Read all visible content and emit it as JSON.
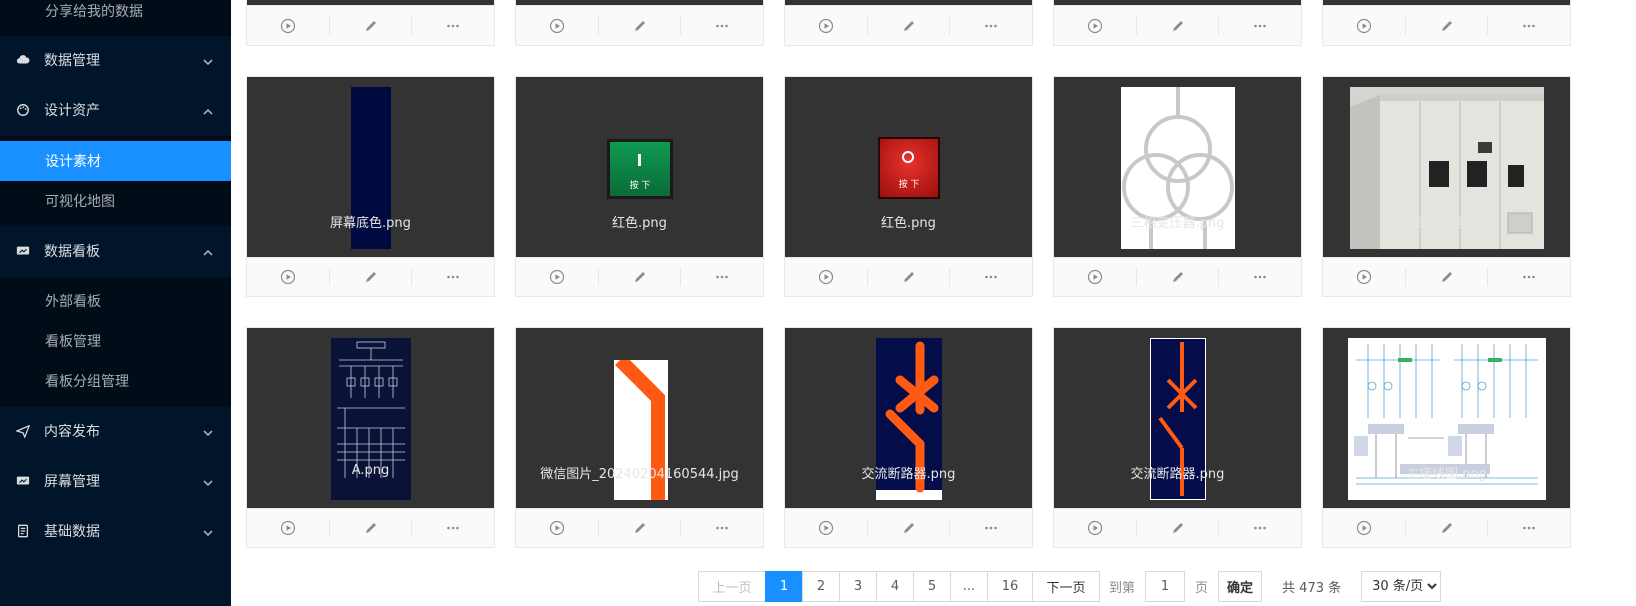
{
  "sidebar": {
    "items": [
      {
        "label": "分享给我的数据",
        "type": "sub"
      },
      {
        "label": "数据管理",
        "type": "top",
        "icon": "cloud-icon"
      },
      {
        "label": "设计资产",
        "type": "top",
        "icon": "palette-icon"
      },
      {
        "label": "设计素材",
        "type": "sub",
        "selected": true
      },
      {
        "label": "可视化地图",
        "type": "sub"
      },
      {
        "label": "数据看板",
        "type": "top",
        "icon": "dashboard-icon"
      },
      {
        "label": "外部看板",
        "type": "sub"
      },
      {
        "label": "看板管理",
        "type": "sub"
      },
      {
        "label": "看板分组管理",
        "type": "sub"
      },
      {
        "label": "内容发布",
        "type": "top",
        "icon": "send-icon"
      },
      {
        "label": "屏幕管理",
        "type": "top",
        "icon": "screen-icon"
      },
      {
        "label": "基础数据",
        "type": "top",
        "icon": "file-icon"
      }
    ]
  },
  "cards": [
    {
      "name": "屏幕底色.png"
    },
    {
      "name": "红色.png"
    },
    {
      "name": "红色.png"
    },
    {
      "name": "三相变压器.png"
    },
    {
      "name": "双相变流器.png"
    },
    {
      "name": "A.png"
    },
    {
      "name": "微信图片_20240204160544.jpg"
    },
    {
      "name": "交流断路器.png"
    },
    {
      "name": "交流断路器.png"
    },
    {
      "name": "主接线图.png"
    }
  ],
  "thumb_labels": {
    "green_button": "按 下",
    "red_button": "按 下"
  },
  "pagination": {
    "prev": "上一页",
    "pages": [
      "1",
      "2",
      "3",
      "4",
      "5",
      "...",
      "16"
    ],
    "current": "1",
    "next": "下一页",
    "goto_label": "到第",
    "goto_value": "1",
    "page_unit": "页",
    "confirm": "确定",
    "total": "共 473 条",
    "page_size": "30 条/页"
  },
  "colors": {
    "sidebar_bg": "#001529",
    "submenu_bg": "#000c17",
    "accent": "#1890ff",
    "cover_bg": "#333333"
  }
}
